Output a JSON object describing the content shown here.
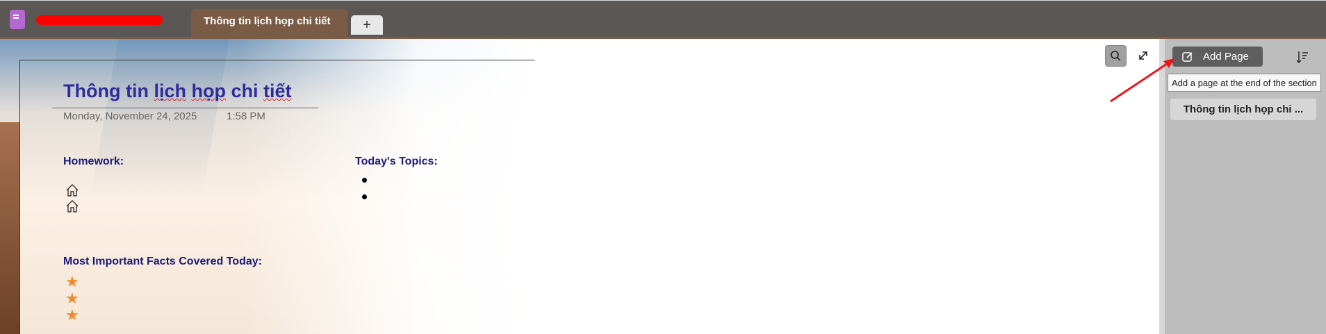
{
  "notebook": {
    "name_redacted": true,
    "icon": "notebook-icon"
  },
  "tabs": [
    {
      "label": "Thông tin lịch họp chi tiết"
    }
  ],
  "tab_add_label": "+",
  "page": {
    "title": "Thông tin lịch họp chi tiết",
    "title_parts": [
      "Thông tin ",
      "lịch",
      " ",
      "họp",
      " chi ",
      "tiết"
    ],
    "date": "Monday, November 24, 2025",
    "time": "1:58 PM",
    "homework_heading": "Homework:",
    "topics_heading": "Today's Topics:",
    "facts_heading": "Most Important Facts Covered Today:",
    "homework_icons": [
      "house-icon",
      "house-icon"
    ],
    "topic_bullets": 2,
    "fact_stars": [
      "★",
      "★",
      "★"
    ]
  },
  "toolbar": {
    "search_icon": "search-icon",
    "expand_icon": "expand-icon"
  },
  "sidebar": {
    "add_page_label": "Add Page",
    "add_page_tooltip": "Add a page at the end of the section",
    "sort_icon": "sort-icon",
    "pages": [
      {
        "label": "Thông tin lịch họp chi ..."
      }
    ]
  },
  "colors": {
    "title": "#2e2b9a",
    "heading": "#1c1a7a",
    "star": "#f08b2a",
    "annotation_arrow": "#e8161a",
    "tab": "#7a5c46"
  }
}
